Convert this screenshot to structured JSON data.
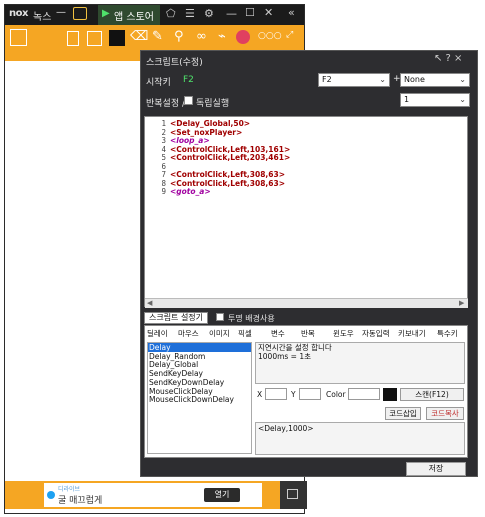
{
  "nox": {
    "logo": "nox",
    "app_name": "녹스",
    "dash": "—",
    "store_label": "앱 스토어",
    "ad": {
      "sponsor": "디라이브",
      "text": "굴 매끄럽게",
      "button": "열기"
    }
  },
  "dialog": {
    "title": "스크립트(수정)",
    "ctrl_icons": "↖ ? ×",
    "start_key_label": "시작키",
    "start_key_value": "F2",
    "combo_key": "F2",
    "plus": "+",
    "combo_mod": "None",
    "repeat_label": "반복설정 /",
    "standalone_label": "독립실행",
    "repeat_value": "1",
    "lines": [
      {
        "no": "1",
        "text": "<Delay_Global,50>"
      },
      {
        "no": "2",
        "text": "<Set_noxPlayer>"
      },
      {
        "no": "3",
        "text": "<loop_a>"
      },
      {
        "no": "4",
        "text": "<ControlClick,Left,103,161>"
      },
      {
        "no": "5",
        "text": "<ControlClick,Left,203,461>"
      },
      {
        "no": "6",
        "text": ""
      },
      {
        "no": "7",
        "text": "<ControlClick,Left,308,63>"
      },
      {
        "no": "8",
        "text": "<ControlClick,Left,308,63>"
      },
      {
        "no": "9",
        "text": "<goto_a>"
      }
    ],
    "script_settings_tab": "스크립트 설정기",
    "transparent_bg_label": "투명 배경사용",
    "panel_tabs": [
      "딜레이",
      "마우스",
      "이미지",
      "픽셀",
      "변수",
      "반복",
      "윈도우",
      "자동입력",
      "키보내기",
      "특수키"
    ],
    "list_items": [
      "Delay",
      "Delay_Random",
      "Delay_Global",
      "SendKeyDelay",
      "SendKeyDownDelay",
      "MouseClickDelay",
      "MouseClickDownDelay"
    ],
    "description": "지연시간을 설정 합니다\n1000ms = 1초",
    "x_label": "X",
    "y_label": "Y",
    "color_label": "Color",
    "capture_btn": "스캔(F12)",
    "insert_code_btn": "코드삽입",
    "copy_code_btn": "코드복사",
    "preview": "<Delay,1000>",
    "save_btn": "저장"
  },
  "colors": {
    "nox_orange": "#f5a623",
    "dialog_bg": "#2d2d30",
    "code_red": "#a00000",
    "code_purple": "#a000a0",
    "selection_blue": "#1e6fd9"
  }
}
